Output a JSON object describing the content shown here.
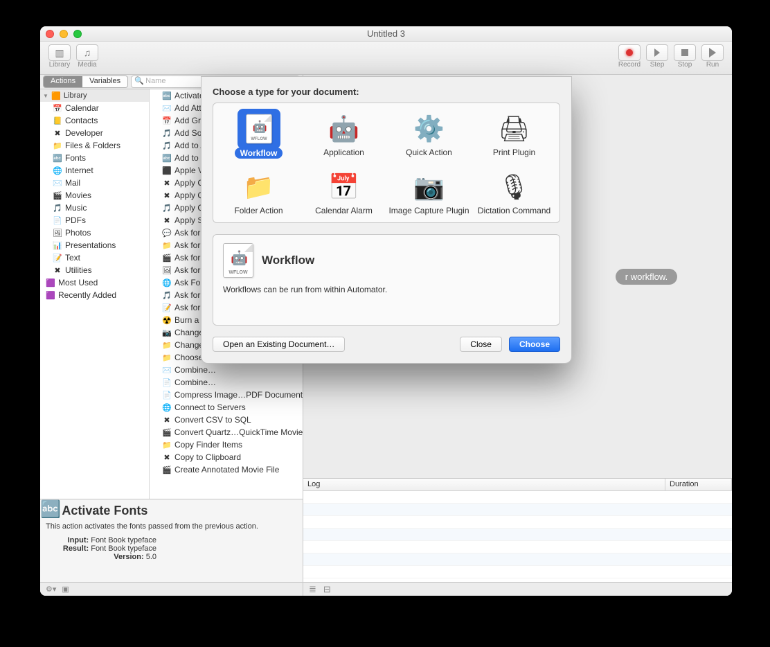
{
  "window": {
    "title": "Untitled 3"
  },
  "toolbar": {
    "library": "Library",
    "media": "Media",
    "record": "Record",
    "step": "Step",
    "stop": "Stop",
    "run": "Run"
  },
  "tabs": {
    "actions": "Actions",
    "variables": "Variables",
    "search_placeholder": "Name"
  },
  "library": {
    "header": "Library",
    "items": [
      {
        "label": "Calendar",
        "icon": "📅"
      },
      {
        "label": "Contacts",
        "icon": "📒"
      },
      {
        "label": "Developer",
        "icon": "✖"
      },
      {
        "label": "Files & Folders",
        "icon": "📁"
      },
      {
        "label": "Fonts",
        "icon": "🔤"
      },
      {
        "label": "Internet",
        "icon": "🌐"
      },
      {
        "label": "Mail",
        "icon": "✉️"
      },
      {
        "label": "Movies",
        "icon": "🎬"
      },
      {
        "label": "Music",
        "icon": "🎵"
      },
      {
        "label": "PDFs",
        "icon": "📄"
      },
      {
        "label": "Photos",
        "icon": "🖼"
      },
      {
        "label": "Presentations",
        "icon": "📊"
      },
      {
        "label": "Text",
        "icon": "📝"
      },
      {
        "label": "Utilities",
        "icon": "✖"
      }
    ],
    "smart": [
      {
        "label": "Most Used",
        "icon": "🟪"
      },
      {
        "label": "Recently Added",
        "icon": "🟪"
      }
    ]
  },
  "actions": [
    {
      "label": "Activate…",
      "icon": "🔤"
    },
    {
      "label": "Add Atta…",
      "icon": "✉️"
    },
    {
      "label": "Add Grid…",
      "icon": "📅"
    },
    {
      "label": "Add Son…",
      "icon": "🎵"
    },
    {
      "label": "Add to A…",
      "icon": "🎵"
    },
    {
      "label": "Add to P…",
      "icon": "🔤"
    },
    {
      "label": "Apple Ve…",
      "icon": "⬛"
    },
    {
      "label": "Apply Co…",
      "icon": "✖"
    },
    {
      "label": "Apply Qu…",
      "icon": "✖"
    },
    {
      "label": "Apply Qu…",
      "icon": "🎵"
    },
    {
      "label": "Apply SQ…",
      "icon": "✖"
    },
    {
      "label": "Ask for C…",
      "icon": "💬"
    },
    {
      "label": "Ask for F…",
      "icon": "📁"
    },
    {
      "label": "Ask for M…",
      "icon": "🎬"
    },
    {
      "label": "Ask for P…",
      "icon": "🖼"
    },
    {
      "label": "Ask For S…",
      "icon": "🌐"
    },
    {
      "label": "Ask for S…",
      "icon": "🎵"
    },
    {
      "label": "Ask for T…",
      "icon": "📝"
    },
    {
      "label": "Burn a D…",
      "icon": "☢️"
    },
    {
      "label": "Change …",
      "icon": "📷"
    },
    {
      "label": "Change …",
      "icon": "📁"
    },
    {
      "label": "Choose …",
      "icon": "📁"
    },
    {
      "label": "Combine…",
      "icon": "✉️"
    },
    {
      "label": "Combine…",
      "icon": "📄"
    },
    {
      "label": "Compress Image…PDF Documents",
      "icon": "📄"
    },
    {
      "label": "Connect to Servers",
      "icon": "🌐"
    },
    {
      "label": "Convert CSV to SQL",
      "icon": "✖"
    },
    {
      "label": "Convert Quartz…QuickTime Movies",
      "icon": "🎬"
    },
    {
      "label": "Copy Finder Items",
      "icon": "📁"
    },
    {
      "label": "Copy to Clipboard",
      "icon": "✖"
    },
    {
      "label": "Create Annotated Movie File",
      "icon": "🎬"
    }
  ],
  "preview": {
    "title": "Activate Fonts",
    "desc": "This action activates the fonts passed from the previous action.",
    "input_label": "Input:",
    "input_value": "Font Book typeface",
    "result_label": "Result:",
    "result_value": "Font Book typeface",
    "version_label": "Version:",
    "version_value": "5.0"
  },
  "workspace": {
    "hint": "r workflow."
  },
  "log": {
    "col_log": "Log",
    "col_duration": "Duration"
  },
  "sheet": {
    "title": "Choose a type for your document:",
    "types": [
      {
        "label": "Workflow",
        "icon": "wflow",
        "selected": true
      },
      {
        "label": "Application",
        "icon": "🤖"
      },
      {
        "label": "Quick Action",
        "icon": "⚙️"
      },
      {
        "label": "Print Plugin",
        "icon": "🖨"
      },
      {
        "label": "Folder Action",
        "icon": "📁"
      },
      {
        "label": "Calendar Alarm",
        "icon": "📅"
      },
      {
        "label": "Image Capture Plugin",
        "icon": "📷"
      },
      {
        "label": "Dictation Command",
        "icon": "🎙"
      }
    ],
    "desc_title": "Workflow",
    "desc_text": "Workflows can be run from within Automator.",
    "btn_open": "Open an Existing Document…",
    "btn_close": "Close",
    "btn_choose": "Choose"
  }
}
